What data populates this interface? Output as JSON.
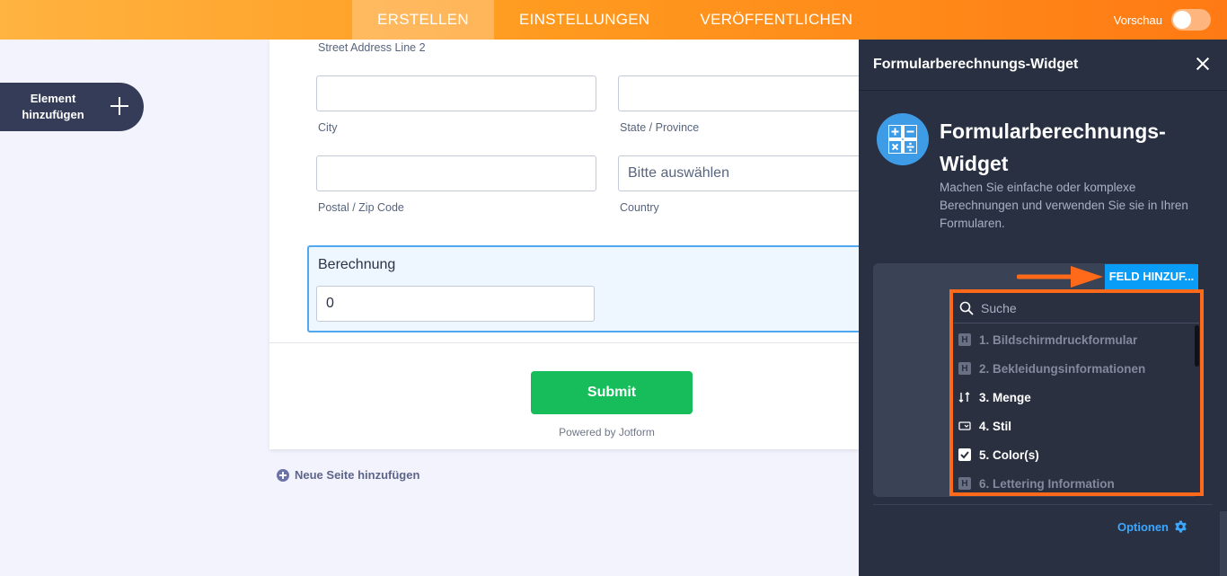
{
  "topbar": {
    "tabs": [
      {
        "label": "ERSTELLEN",
        "active": true
      },
      {
        "label": "EINSTELLUNGEN",
        "active": false
      },
      {
        "label": "VERÖFFENTLICHEN",
        "active": false
      }
    ],
    "preview_label": "Vorschau",
    "preview_on": false
  },
  "sidebar": {
    "add_element_label_1": "Element",
    "add_element_label_2": "hinzufügen"
  },
  "form": {
    "street2_label": "Street Address Line 2",
    "city_label": "City",
    "state_label": "State / Province",
    "postal_label": "Postal / Zip Code",
    "country_label": "Country",
    "country_placeholder": "Bitte auswählen",
    "calc_label": "Berechnung",
    "calc_value": "0",
    "submit_label": "Submit",
    "powered_by": "Powered by Jotform",
    "new_page_label": "Neue Seite hinzufügen"
  },
  "panel": {
    "title": "Formularberechnungs-Widget",
    "widget_name": "Formularberechnungs-Widget",
    "widget_desc": "Machen Sie einfache oder komplexe Berechnungen und verwenden Sie sie in Ihren Formularen.",
    "add_field_label": "FELD HINZUF...",
    "search_placeholder": "Suche",
    "fields": [
      {
        "label": "1. Bildschirmdruckformular",
        "icon": "header-icon",
        "enabled": false
      },
      {
        "label": "2. Bekleidungsinformationen",
        "icon": "header-icon",
        "enabled": false
      },
      {
        "label": "3. Menge",
        "icon": "sort-icon",
        "enabled": true
      },
      {
        "label": "4. Stil",
        "icon": "dropdown-select-icon",
        "enabled": true
      },
      {
        "label": "5. Color(s)",
        "icon": "checkbox-icon",
        "enabled": true
      },
      {
        "label": "6. Lettering Information",
        "icon": "header-icon",
        "enabled": false
      }
    ],
    "options_label": "Optionen"
  },
  "colors": {
    "accent_orange": "#ff7a14",
    "panel_bg": "#293042",
    "submit_green": "#18bd5b",
    "button_blue": "#0a9df8",
    "highlight_orange": "#ff6a1a"
  }
}
